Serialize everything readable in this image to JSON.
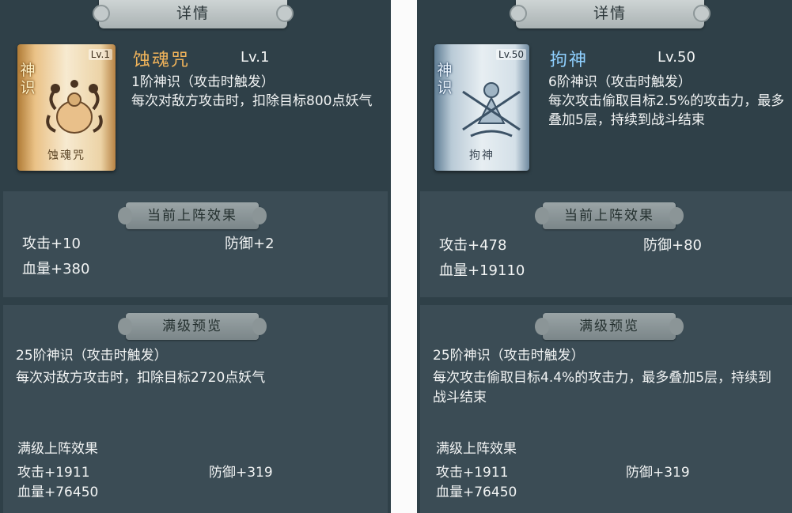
{
  "panels": [
    {
      "title": "详情",
      "card": {
        "badge": "神识",
        "level_tag": "Lv.1",
        "name": "蚀魂咒"
      },
      "skill_name": "蚀魂咒",
      "level": "Lv.1",
      "desc_line1": "1阶神识（攻击时触发）",
      "desc_line2": "每次对敌方攻击时，扣除目标800点妖气",
      "current_title": "当前上阵效果",
      "current": {
        "attack": "攻击+10",
        "defense": "防御+2",
        "hp": "血量+380"
      },
      "preview_title": "满级预览",
      "preview_tier": "25阶神识（攻击时触发）",
      "preview_desc": "每次对敌方攻击时，扣除目标2720点妖气",
      "max_title": "满级上阵效果",
      "max": {
        "attack": "攻击+1911",
        "defense": "防御+319",
        "hp": "血量+76450"
      }
    },
    {
      "title": "详情",
      "card": {
        "badge": "神识",
        "level_tag": "Lv.50",
        "name": "拘神"
      },
      "skill_name": "拘神",
      "level": "Lv.50",
      "desc_line1": "6阶神识（攻击时触发）",
      "desc_line2": "每次攻击偷取目标2.5%的攻击力，最多叠加5层，持续到战斗结束",
      "current_title": "当前上阵效果",
      "current": {
        "attack": "攻击+478",
        "defense": "防御+80",
        "hp": "血量+19110"
      },
      "preview_title": "满级预览",
      "preview_tier": "25阶神识（攻击时触发）",
      "preview_desc": "每次攻击偷取目标4.4%的攻击力，最多叠加5层，持续到战斗结束",
      "max_title": "满级上阵效果",
      "max": {
        "attack": "攻击+1911",
        "defense": "防御+319",
        "hp": "血量+76450"
      }
    }
  ]
}
